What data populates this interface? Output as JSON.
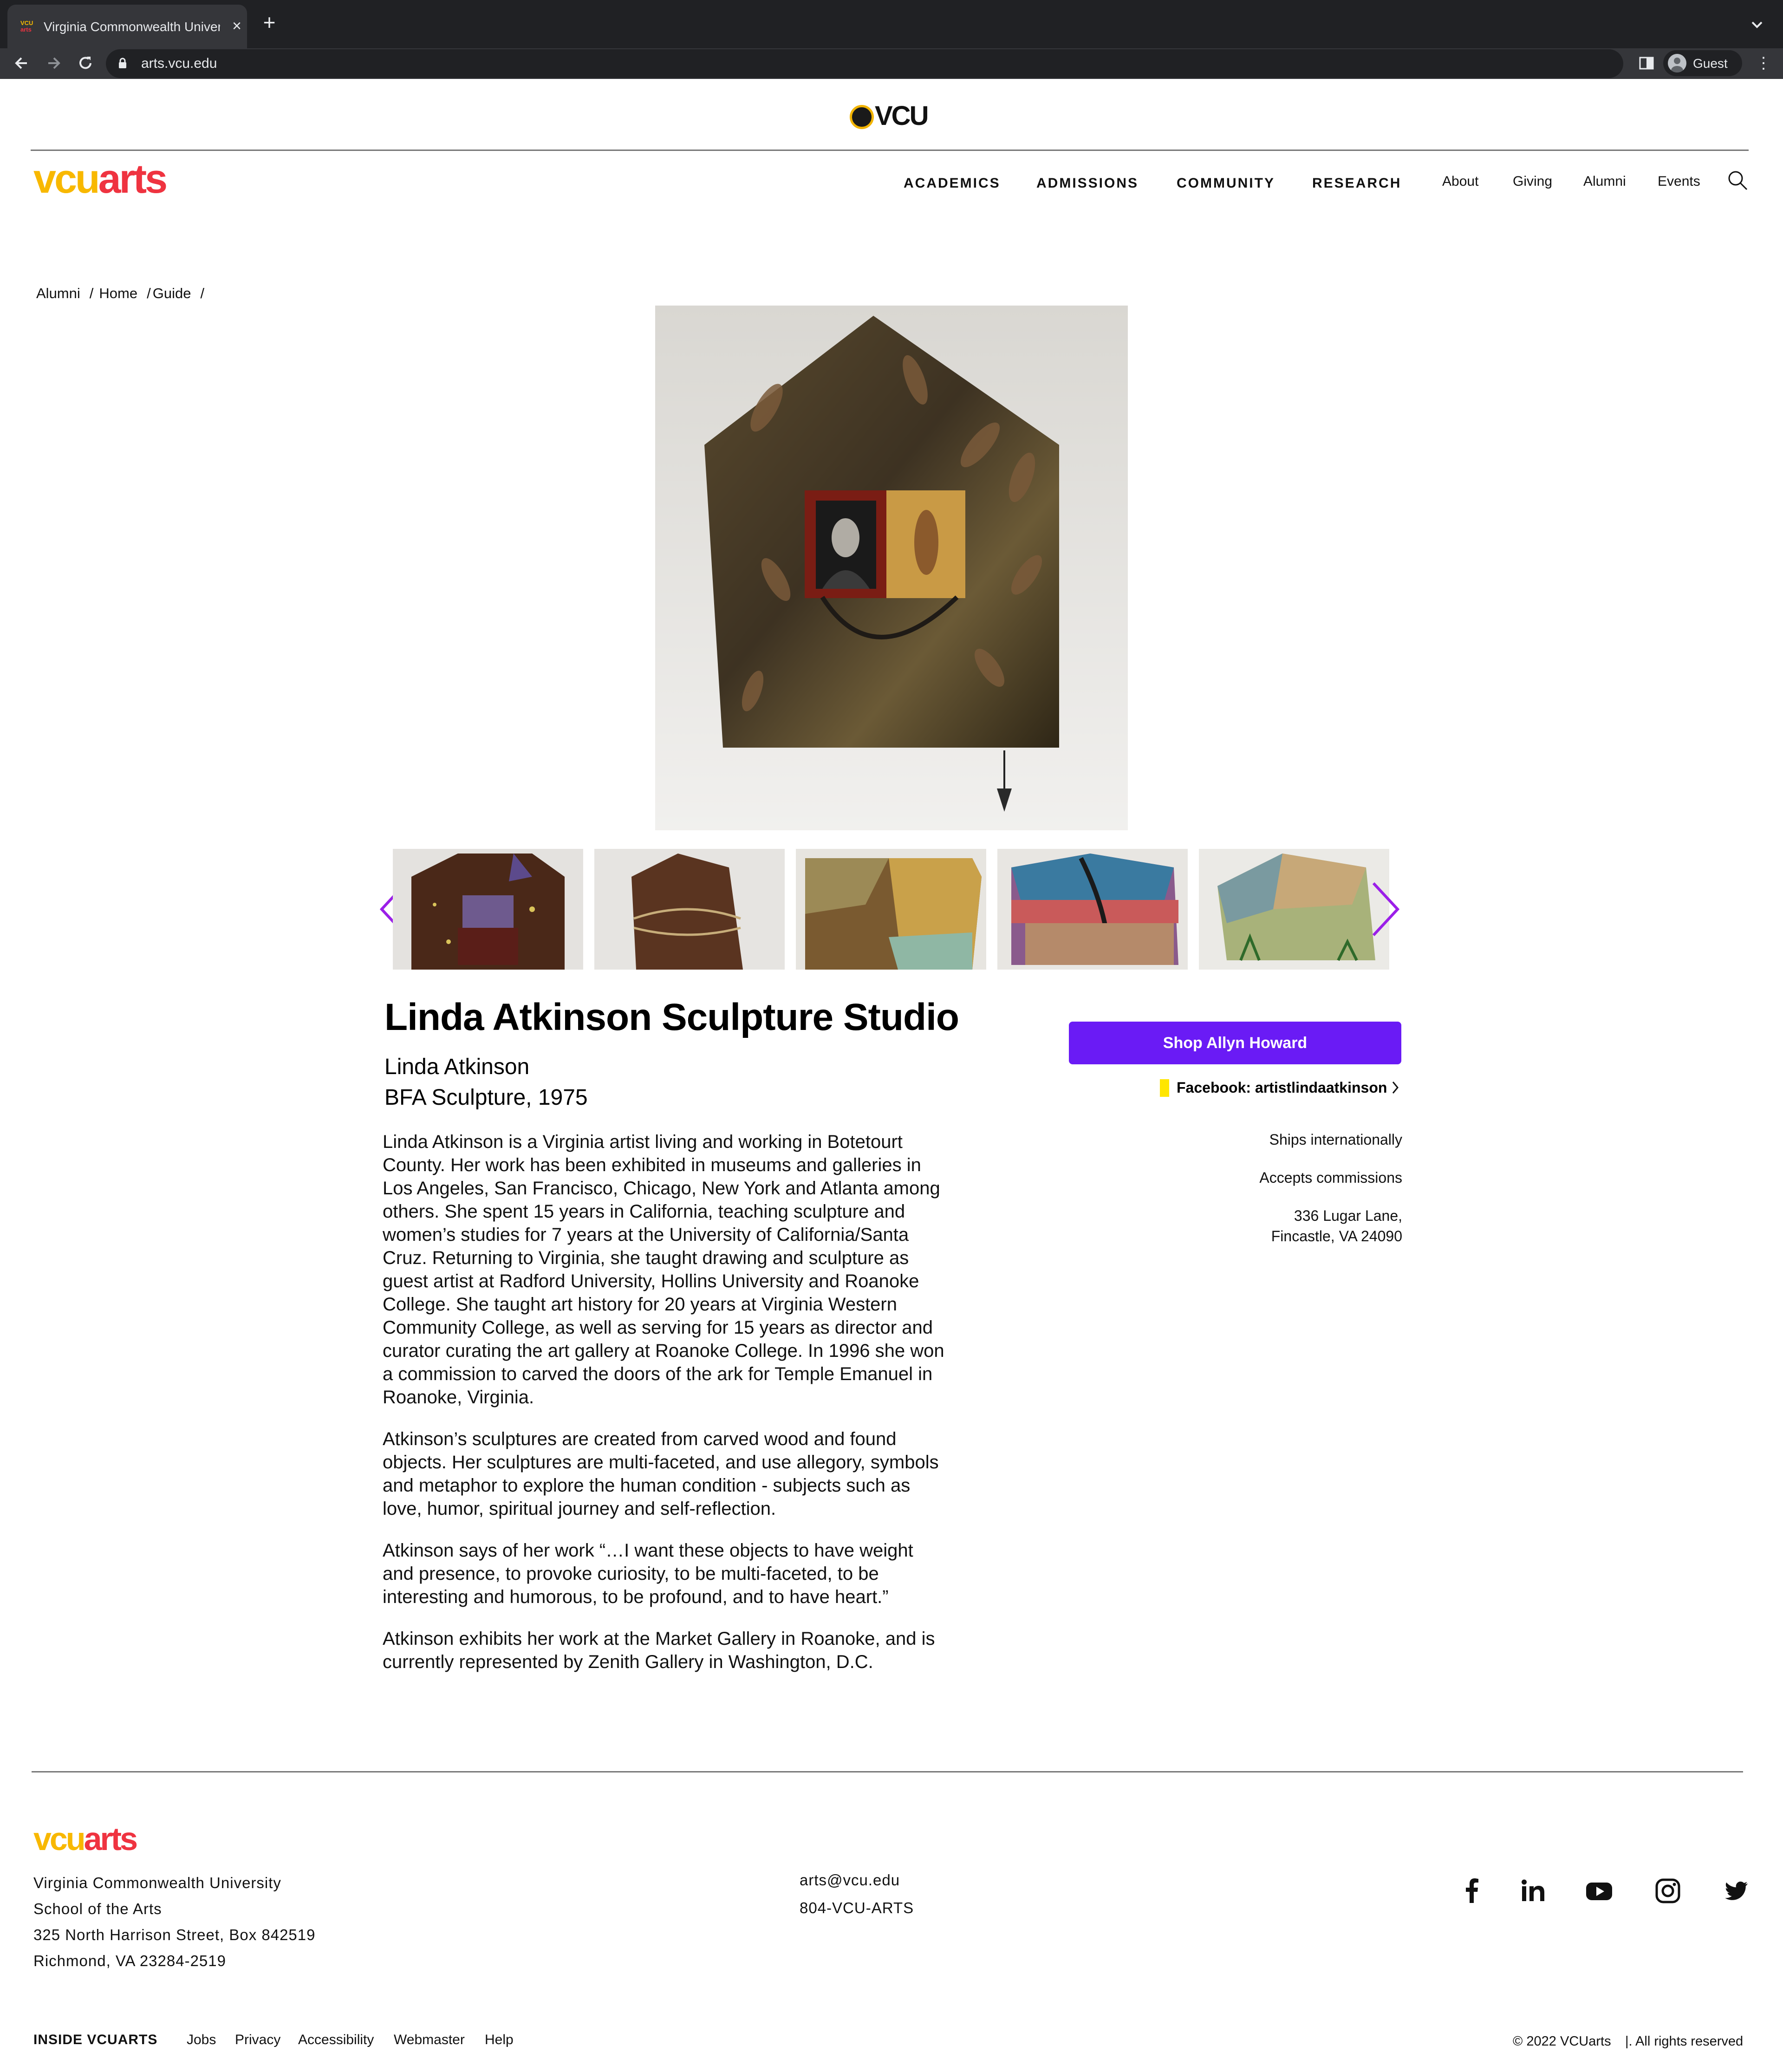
{
  "browser": {
    "tab_title": "Virginia Commonwealth Univer",
    "tab_favicon_top": "VCU",
    "tab_favicon_bottom": "arts",
    "url": "arts.vcu.edu",
    "profile_label": "Guest"
  },
  "header": {
    "vcu_logo_text": "VCU",
    "brand_vcu": "vcu",
    "brand_arts": "arts",
    "main_nav": [
      "ACADEMICS",
      "ADMISSIONS",
      "COMMUNITY",
      "RESEARCH"
    ],
    "util_nav": [
      "About",
      "Giving",
      "Alumni",
      "Events"
    ]
  },
  "breadcrumb": [
    "Alumni",
    "Home",
    "Guide"
  ],
  "listing": {
    "title": "Linda Atkinson Sculpture Studio",
    "artist": "Linda Atkinson",
    "degree": "BFA Sculpture, 1975",
    "bio": [
      "Linda Atkinson is a Virginia artist living and working in Botetourt County. Her work has been exhibited in museums and galleries in Los Angeles, San Francisco, Chicago, New York and Atlanta among others.  She spent 15 years in California, teaching sculpture and women’s studies for 7 years at the University of California/Santa Cruz. Returning to Virginia, she taught drawing and  sculpture as guest artist at Radford University, Hollins University and Roanoke College.   She taught art history for 20 years at Virginia Western Community College, as well as serving for 15 years as director and curator curating the art gallery at Roanoke College. In 1996 she won a commission to carved the doors of the ark for Temple Emanuel in Roanoke, Virginia.",
      " Atkinson’s sculptures are created  from carved wood and found objects. Her sculptures  are multi-faceted,  and use allegory, symbols and metaphor to explore the human condition - subjects such as love, humor, spiritual journey and self-reflection.",
      "Atkinson says of her work “…I want these objects to have weight and presence, to provoke curiosity, to be multi-faceted, to be interesting and humorous, to be profound, and to have heart.”",
      "Atkinson exhibits her work at the Market Gallery in Roanoke, and is currently represented by Zenith Gallery in Washington, D.C."
    ],
    "shop_button": "Shop Allyn Howard",
    "facebook_label": "Facebook: artistlindaatkinson",
    "ships": "Ships internationally",
    "commissions": "Accepts commissions",
    "address_line1": "336 Lugar Lane,",
    "address_line2": "Fincastle, VA  24090"
  },
  "footer": {
    "address": [
      "Virginia Commonwealth University",
      "School of the Arts",
      "325 North Harrison Street, Box 842519",
      "Richmond, VA 23284-2519"
    ],
    "email": "arts@vcu.edu",
    "phone": "804-VCU-ARTS",
    "social": [
      "facebook-icon",
      "linkedin-icon",
      "youtube-icon",
      "instagram-icon",
      "twitter-icon"
    ],
    "inside_label": "INSIDE VCUARTS",
    "links": [
      "Jobs",
      "Privacy",
      "Accessibility",
      "Webmaster",
      "Help"
    ],
    "copyright": "© 2022 VCUarts",
    "rights": "|.  All rights reserved"
  },
  "colors": {
    "brand_yellow": "#f8b800",
    "brand_red": "#ef3340",
    "shop_button": "#6a1bf5",
    "carousel_arrows": "#9b1fe8",
    "facebook_marker": "#ffe600"
  }
}
